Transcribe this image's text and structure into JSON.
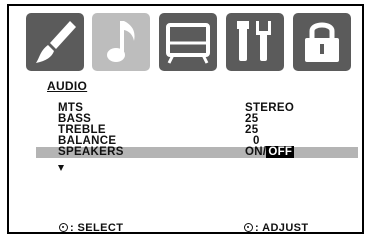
{
  "menu": {
    "tabs": [
      {
        "icon": "brush-icon",
        "active": false
      },
      {
        "icon": "music-note-icon",
        "active": true
      },
      {
        "icon": "tv-screen-icon",
        "active": false
      },
      {
        "icon": "tools-icon",
        "active": false
      },
      {
        "icon": "lock-icon",
        "active": false
      }
    ],
    "title": "AUDIO",
    "rows": [
      {
        "label": "MTS",
        "value": "STEREO"
      },
      {
        "label": "BASS",
        "value": "25"
      },
      {
        "label": "TREBLE",
        "value": "25"
      },
      {
        "label": "BALANCE",
        "value": "0"
      },
      {
        "label": "SPEAKERS",
        "value_on": "ON/",
        "value_off": "OFF",
        "selected": true
      }
    ]
  },
  "footer": {
    "select_label": ": SELECT",
    "adjust_label": ": ADJUST"
  },
  "colors": {
    "tab_dark": "#5b5b5b",
    "tab_active": "#bdbdbd",
    "highlight": "#b4b4b4"
  }
}
